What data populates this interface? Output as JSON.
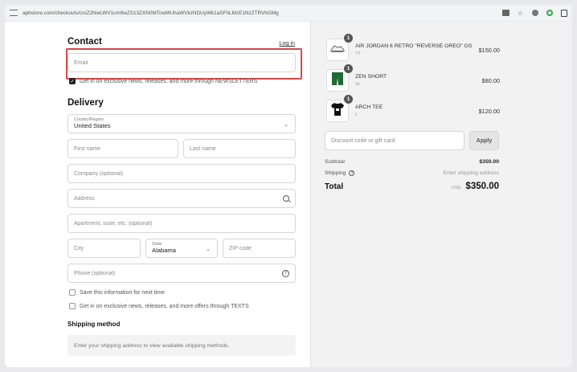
{
  "browser": {
    "url": "apbstore.com/checkouts/cn/Z2NwLWV1cm9wZS13ZXN0MTowMUhaWVkzNDUyWk1aSFhLMzE1NzZTRVhGMg",
    "icons": [
      "tune-icon",
      "translate-icon",
      "star-icon",
      "extension-icon",
      "target-extension-icon",
      "sidepanel-icon"
    ]
  },
  "contact": {
    "title": "Contact",
    "login": "Log in",
    "email_placeholder": "Email",
    "newsletter_label": "Get in on exclusive news, releases, and more through NEWSLETTERS",
    "newsletter_checked": true
  },
  "delivery": {
    "title": "Delivery",
    "country_label": "Country/Region",
    "country_value": "United States",
    "first_name": "First name",
    "last_name": "Last name",
    "company": "Company (optional)",
    "address": "Address",
    "apartment": "Apartment, suite, etc. (optional)",
    "city": "City",
    "state_label": "State",
    "state_value": "Alabama",
    "zip": "ZIP code",
    "phone": "Phone (optional)",
    "save_info": "Save this information for next time",
    "texts_optin": "Get in on exclusive news, releases, and more offers through TEXTS"
  },
  "shipping_method": {
    "title": "Shipping method",
    "message": "Enter your shipping address to view available shipping methods."
  },
  "cart": {
    "items": [
      {
        "name": "AIR JORDAN 6 RETRO \"REVERSE OREO\" GS",
        "variant": "7Y",
        "price": "$150.00",
        "qty": "1",
        "icon": "sneaker-icon"
      },
      {
        "name": "ZEN SHORT",
        "variant": "XL",
        "price": "$80.00",
        "qty": "1",
        "icon": "shorts-icon"
      },
      {
        "name": "ARCH TEE",
        "variant": "L",
        "price": "$120.00",
        "qty": "1",
        "icon": "tshirt-icon"
      }
    ],
    "discount_placeholder": "Discount code or gift card",
    "apply": "Apply",
    "subtotal_label": "Subtotal",
    "subtotal": "$350.00",
    "shipping_label": "Shipping",
    "shipping_value": "Enter shipping address",
    "total_label": "Total",
    "currency": "USD",
    "total": "$350.00"
  },
  "colors": {
    "highlight": "#d44a4a",
    "right_panel_bg": "#f2f2f2"
  }
}
